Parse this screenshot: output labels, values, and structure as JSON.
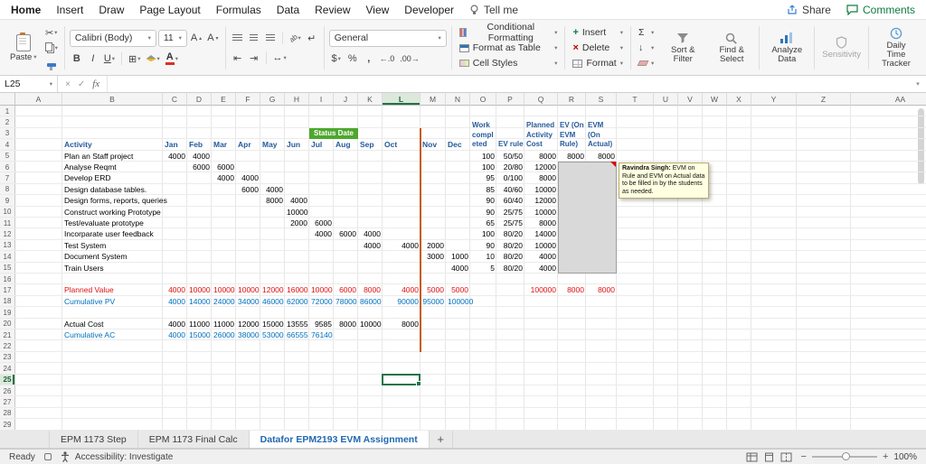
{
  "chrome": {
    "menu": {
      "items": [
        "Home",
        "Insert",
        "Draw",
        "Page Layout",
        "Formulas",
        "Data",
        "Review",
        "View",
        "Developer"
      ],
      "tell_me": "Tell me",
      "share": "Share",
      "comments": "Comments"
    },
    "ribbon": {
      "paste_label": "Paste",
      "font_name": "Calibri (Body)",
      "font_size": "11",
      "bold": "B",
      "italic": "I",
      "underline": "U",
      "number_format": "General",
      "currency": "$",
      "percent": "%",
      "comma": ",",
      "dec_more": "←.0",
      "dec_less": ".00→",
      "styles": [
        {
          "label": "Conditional Formatting"
        },
        {
          "label": "Format as Table"
        },
        {
          "label": "Cell Styles"
        }
      ],
      "cells": [
        {
          "label": "Insert"
        },
        {
          "label": "Delete"
        },
        {
          "label": "Format"
        }
      ],
      "sigma": "Σ",
      "sort_filter": "Sort & Filter",
      "find_select": "Find & Select",
      "analyze": "Analyze Data",
      "sensitivity": "Sensitivity",
      "tracker": "Daily Time Tracker"
    },
    "formula_bar": {
      "name_box": "L25",
      "fx": "fx"
    },
    "sheet_tabs": {
      "tabs": [
        {
          "label": "EPM 1173 Step",
          "active": false
        },
        {
          "label": "EPM 1173 Final Calc",
          "active": false
        },
        {
          "label": "Datafor EPM2193 EVM Assignment",
          "active": true
        }
      ],
      "add_label": "+"
    },
    "status_bar": {
      "ready": "Ready",
      "accessibility": "Accessibility: Investigate",
      "zoom": "100%"
    }
  },
  "comment": {
    "author": "Ravindra Singh:",
    "body": "EVM on Rule and EVM on Actual data to be filled in by the students as needed."
  },
  "grid": {
    "row_header_width": 17,
    "col_header_height": 14,
    "row_height": 12.4,
    "row_count": 29,
    "selection": {
      "col": "L",
      "row": 25
    },
    "columns": [
      [
        "A",
        52
      ],
      [
        "B",
        111
      ],
      [
        "C",
        27
      ],
      [
        "D",
        27
      ],
      [
        "E",
        27
      ],
      [
        "F",
        27
      ],
      [
        "G",
        27
      ],
      [
        "H",
        27
      ],
      [
        "I",
        27
      ],
      [
        "J",
        27
      ],
      [
        "K",
        27
      ],
      [
        "L",
        42
      ],
      [
        "M",
        28
      ],
      [
        "N",
        27
      ],
      [
        "O",
        29
      ],
      [
        "P",
        31
      ],
      [
        "Q",
        37
      ],
      [
        "R",
        31
      ],
      [
        "S",
        34
      ],
      [
        "T",
        41
      ],
      [
        "U",
        27
      ],
      [
        "V",
        27
      ],
      [
        "W",
        27
      ],
      [
        "X",
        27
      ],
      [
        "Y",
        50
      ],
      [
        "Z",
        60
      ],
      [
        "AA",
        110
      ]
    ],
    "wrapped_headers": [
      {
        "c": "O",
        "t": "Work\ncompl\neted"
      },
      {
        "c": "P",
        "t": "EV rule"
      },
      {
        "c": "Q",
        "t": "Planned\nActivity\nCost"
      },
      {
        "c": "R",
        "t": "EV (On\nEVM\nRule)"
      },
      {
        "c": "S",
        "t": "EVM\n(On\nActual)"
      }
    ],
    "status_badge": {
      "label": "Status Date",
      "col": "I",
      "row": 3,
      "w": 54
    },
    "status_line": {
      "col_after": "L",
      "from_row": 3,
      "to_row": 22
    },
    "gray_box": {
      "c1": "R",
      "c2": "S",
      "r1": 6,
      "r2": 15
    },
    "cells": [
      [
        4,
        "B",
        "Activity",
        "hdr"
      ],
      [
        4,
        "C",
        "Jan",
        "hdr"
      ],
      [
        4,
        "D",
        "Feb",
        "hdr"
      ],
      [
        4,
        "E",
        "Mar",
        "hdr"
      ],
      [
        4,
        "F",
        "Apr",
        "hdr"
      ],
      [
        4,
        "G",
        "May",
        "hdr"
      ],
      [
        4,
        "H",
        "Jun",
        "hdr"
      ],
      [
        4,
        "I",
        "Jul",
        "hdr"
      ],
      [
        4,
        "J",
        "Aug",
        "hdr"
      ],
      [
        4,
        "K",
        "Sep",
        "hdr"
      ],
      [
        4,
        "L",
        "Oct",
        "hdr"
      ],
      [
        4,
        "M",
        "Nov",
        "hdr"
      ],
      [
        4,
        "N",
        "Dec",
        "hdr"
      ],
      [
        5,
        "B",
        "Plan an Staff project",
        "txt"
      ],
      [
        5,
        "C",
        "4000",
        "num"
      ],
      [
        5,
        "D",
        "4000",
        "num"
      ],
      [
        5,
        "O",
        "100",
        "num"
      ],
      [
        5,
        "P",
        "50/50",
        "num"
      ],
      [
        5,
        "Q",
        "8000",
        "num"
      ],
      [
        5,
        "R",
        "8000",
        "num"
      ],
      [
        5,
        "S",
        "8000",
        "num"
      ],
      [
        6,
        "B",
        "Analyse Reqmt",
        "txt"
      ],
      [
        6,
        "D",
        "6000",
        "num"
      ],
      [
        6,
        "E",
        "6000",
        "num"
      ],
      [
        6,
        "O",
        "100",
        "num"
      ],
      [
        6,
        "P",
        "20/80",
        "num"
      ],
      [
        6,
        "Q",
        "12000",
        "num"
      ],
      [
        7,
        "B",
        "Develop ERD",
        "txt"
      ],
      [
        7,
        "E",
        "4000",
        "num"
      ],
      [
        7,
        "F",
        "4000",
        "num"
      ],
      [
        7,
        "O",
        "95",
        "num"
      ],
      [
        7,
        "P",
        "0/100",
        "num"
      ],
      [
        7,
        "Q",
        "8000",
        "num"
      ],
      [
        8,
        "B",
        "Design database tables.",
        "txt"
      ],
      [
        8,
        "F",
        "6000",
        "num"
      ],
      [
        8,
        "G",
        "4000",
        "num"
      ],
      [
        8,
        "O",
        "85",
        "num"
      ],
      [
        8,
        "P",
        "40/60",
        "num"
      ],
      [
        8,
        "Q",
        "10000",
        "num"
      ],
      [
        9,
        "B",
        "Design forms, reports, queries",
        "txt"
      ],
      [
        9,
        "G",
        "8000",
        "num"
      ],
      [
        9,
        "H",
        "4000",
        "num"
      ],
      [
        9,
        "O",
        "90",
        "num"
      ],
      [
        9,
        "P",
        "60/40",
        "num"
      ],
      [
        9,
        "Q",
        "12000",
        "num"
      ],
      [
        10,
        "B",
        "Construct working Prototype",
        "txt"
      ],
      [
        10,
        "H",
        "10000",
        "num"
      ],
      [
        10,
        "O",
        "90",
        "num"
      ],
      [
        10,
        "P",
        "25/75",
        "num"
      ],
      [
        10,
        "Q",
        "10000",
        "num"
      ],
      [
        11,
        "B",
        "Test/evaluate prototype",
        "txt"
      ],
      [
        11,
        "H",
        "2000",
        "num"
      ],
      [
        11,
        "I",
        "6000",
        "num"
      ],
      [
        11,
        "O",
        "65",
        "num"
      ],
      [
        11,
        "P",
        "25/75",
        "num"
      ],
      [
        11,
        "Q",
        "8000",
        "num"
      ],
      [
        12,
        "B",
        "Incorparate user feedback",
        "txt"
      ],
      [
        12,
        "I",
        "4000",
        "num"
      ],
      [
        12,
        "J",
        "6000",
        "num"
      ],
      [
        12,
        "K",
        "4000",
        "num"
      ],
      [
        12,
        "O",
        "100",
        "num"
      ],
      [
        12,
        "P",
        "80/20",
        "num"
      ],
      [
        12,
        "Q",
        "14000",
        "num"
      ],
      [
        13,
        "B",
        "Test System",
        "txt"
      ],
      [
        13,
        "K",
        "4000",
        "num"
      ],
      [
        13,
        "L",
        "4000",
        "num"
      ],
      [
        13,
        "M",
        "2000",
        "num"
      ],
      [
        13,
        "O",
        "90",
        "num"
      ],
      [
        13,
        "P",
        "80/20",
        "num"
      ],
      [
        13,
        "Q",
        "10000",
        "num"
      ],
      [
        14,
        "B",
        "Document System",
        "txt"
      ],
      [
        14,
        "M",
        "3000",
        "num"
      ],
      [
        14,
        "N",
        "1000",
        "num"
      ],
      [
        14,
        "O",
        "10",
        "num"
      ],
      [
        14,
        "P",
        "80/20",
        "num"
      ],
      [
        14,
        "Q",
        "4000",
        "num"
      ],
      [
        15,
        "B",
        "Train Users",
        "txt"
      ],
      [
        15,
        "N",
        "4000",
        "num"
      ],
      [
        15,
        "O",
        "5",
        "num"
      ],
      [
        15,
        "P",
        "80/20",
        "num"
      ],
      [
        15,
        "Q",
        "4000",
        "num"
      ],
      [
        17,
        "B",
        "Planned Value",
        "redl"
      ],
      [
        17,
        "C",
        "4000",
        "red"
      ],
      [
        17,
        "D",
        "10000",
        "red"
      ],
      [
        17,
        "E",
        "10000",
        "red"
      ],
      [
        17,
        "F",
        "10000",
        "red"
      ],
      [
        17,
        "G",
        "12000",
        "red"
      ],
      [
        17,
        "H",
        "16000",
        "red"
      ],
      [
        17,
        "I",
        "10000",
        "red"
      ],
      [
        17,
        "J",
        "6000",
        "red"
      ],
      [
        17,
        "K",
        "8000",
        "red"
      ],
      [
        17,
        "L",
        "4000",
        "red"
      ],
      [
        17,
        "M",
        "5000",
        "red"
      ],
      [
        17,
        "N",
        "5000",
        "red"
      ],
      [
        17,
        "Q",
        "100000",
        "red"
      ],
      [
        17,
        "R",
        "8000",
        "red"
      ],
      [
        17,
        "S",
        "8000",
        "red"
      ],
      [
        18,
        "B",
        "Cumulative PV",
        "bluel"
      ],
      [
        18,
        "C",
        "4000",
        "blue"
      ],
      [
        18,
        "D",
        "14000",
        "blue"
      ],
      [
        18,
        "E",
        "24000",
        "blue"
      ],
      [
        18,
        "F",
        "34000",
        "blue"
      ],
      [
        18,
        "G",
        "46000",
        "blue"
      ],
      [
        18,
        "H",
        "62000",
        "blue"
      ],
      [
        18,
        "I",
        "72000",
        "blue"
      ],
      [
        18,
        "J",
        "78000",
        "blue"
      ],
      [
        18,
        "K",
        "86000",
        "blue"
      ],
      [
        18,
        "L",
        "90000",
        "blue"
      ],
      [
        18,
        "M",
        "95000",
        "blue"
      ],
      [
        18,
        "N",
        "100000",
        "blue"
      ],
      [
        20,
        "B",
        "Actual Cost",
        "txt"
      ],
      [
        20,
        "C",
        "4000",
        "num"
      ],
      [
        20,
        "D",
        "11000",
        "num"
      ],
      [
        20,
        "E",
        "11000",
        "num"
      ],
      [
        20,
        "F",
        "12000",
        "num"
      ],
      [
        20,
        "G",
        "15000",
        "num"
      ],
      [
        20,
        "H",
        "13555",
        "num"
      ],
      [
        20,
        "I",
        "9585",
        "num"
      ],
      [
        20,
        "J",
        "8000",
        "num"
      ],
      [
        20,
        "K",
        "10000",
        "num"
      ],
      [
        20,
        "L",
        "8000",
        "num"
      ],
      [
        21,
        "B",
        "Cumulative AC",
        "bluel"
      ],
      [
        21,
        "C",
        "4000",
        "blue"
      ],
      [
        21,
        "D",
        "15000",
        "blue"
      ],
      [
        21,
        "E",
        "26000",
        "blue"
      ],
      [
        21,
        "F",
        "38000",
        "blue"
      ],
      [
        21,
        "G",
        "53000",
        "blue"
      ],
      [
        21,
        "H",
        "66555",
        "blue"
      ],
      [
        21,
        "I",
        "76140",
        "blue"
      ]
    ]
  }
}
